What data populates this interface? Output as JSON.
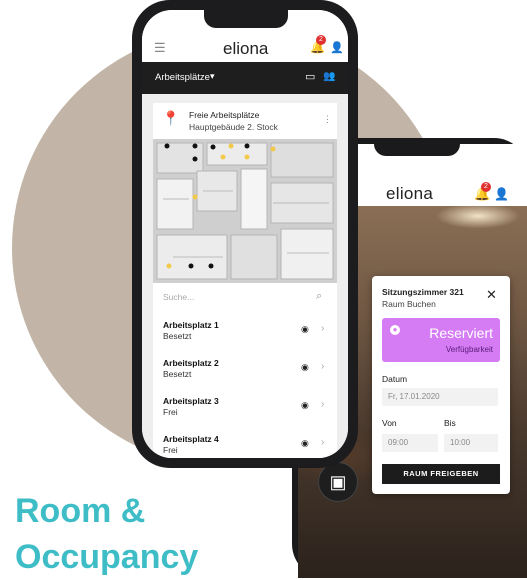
{
  "headline": {
    "line1": "Room &",
    "line2": "Occupancy"
  },
  "colors": {
    "accent_teal": "#3fbdc7",
    "status_purple": "#d57cf5",
    "circle_bg": "#c2b5a8",
    "badge_red": "#e03030"
  },
  "phone_main": {
    "header": {
      "logo": "eliona",
      "menu_icon": "hamburger-icon",
      "bell_icon": "bell-icon",
      "badge_count": "2",
      "user_icon": "user-icon"
    },
    "toolbar": {
      "label": "Arbeitsplätze",
      "chevron": "▾",
      "icon_1": "calendar-icon",
      "icon_2": "people-icon"
    },
    "location_card": {
      "title": "Freie Arbeitsplätze",
      "subtitle": "Hauptgebäude 2. Stock",
      "pin_icon": "map-pin-icon",
      "more_icon": "more-vertical-icon"
    },
    "search": {
      "placeholder": "Suche...",
      "icon": "search-icon"
    },
    "rows": [
      {
        "name": "Arbeitsplatz 1",
        "status": "Besetzt"
      },
      {
        "name": "Arbeitsplatz 2",
        "status": "Besetzt"
      },
      {
        "name": "Arbeitsplatz 3",
        "status": "Frei"
      },
      {
        "name": "Arbeitsplatz 4",
        "status": "Frei"
      }
    ]
  },
  "phone_room": {
    "header": {
      "logo": "eliona",
      "badge_count": "2"
    },
    "fab_icon": "calendar-icon",
    "panel": {
      "title": "Sitzungszimmer 321",
      "subtitle": "Raum Buchen",
      "close": "✕",
      "status_label": "Reserviert",
      "status_sub": "Verfügbarkeit",
      "date_label": "Datum",
      "date_value": "Fr, 17.01.2020",
      "from_label": "Von",
      "to_label": "Bis",
      "from_value": "09:00",
      "to_value": "10:00",
      "release_button": "RAUM FREIGEBEN"
    }
  }
}
